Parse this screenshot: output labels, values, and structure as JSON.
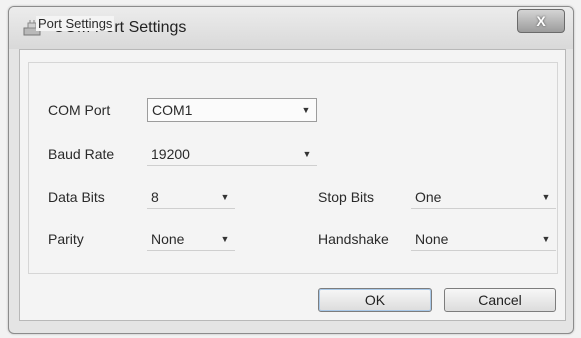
{
  "window": {
    "title": "COM Port Settings",
    "close_label": "X"
  },
  "group": {
    "label": "Port Settings"
  },
  "fields": {
    "com_port": {
      "label": "COM Port",
      "value": "COM1"
    },
    "baud_rate": {
      "label": "Baud Rate",
      "value": "19200"
    },
    "data_bits": {
      "label": "Data Bits",
      "value": "8"
    },
    "stop_bits": {
      "label": "Stop Bits",
      "value": "One"
    },
    "parity": {
      "label": "Parity",
      "value": "None"
    },
    "handshake": {
      "label": "Handshake",
      "value": "None"
    }
  },
  "buttons": {
    "ok": "OK",
    "cancel": "Cancel"
  },
  "icons": {
    "app": "serial-port-icon",
    "dropdown": "chevron-down-icon",
    "close": "close-icon"
  }
}
